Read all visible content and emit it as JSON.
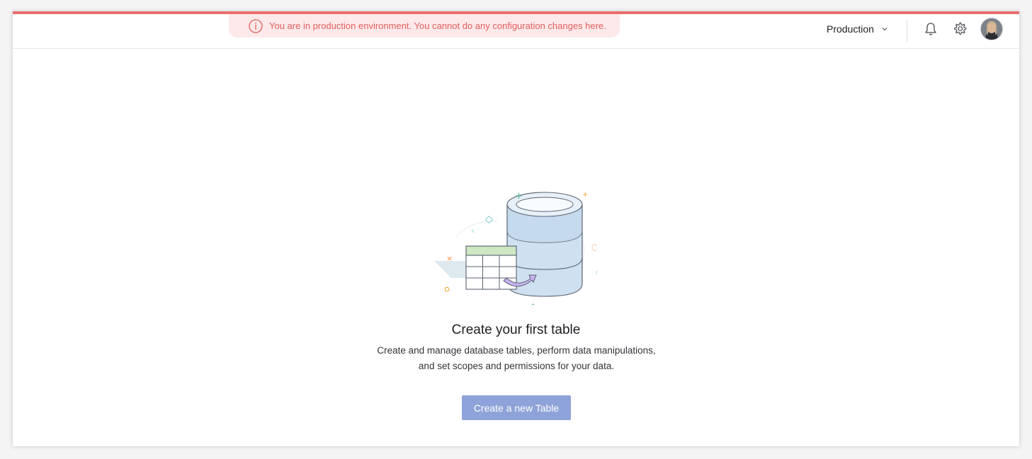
{
  "header": {
    "alert_text": "You are in production environment. You cannot do any configuration changes here.",
    "environment": "Production",
    "icons": [
      "info-icon",
      "chevron-down-icon",
      "bell-icon",
      "gear-icon",
      "avatar"
    ]
  },
  "empty_state": {
    "title": "Create your first table",
    "description_line1": "Create and manage database tables, perform data manipulations,",
    "description_line2": "and set scopes and permissions for your data.",
    "button_label": "Create a new Table"
  },
  "colors": {
    "accent": "#e8706f",
    "alert_bg": "#fde9e9",
    "alert_text": "#e2605f",
    "button_bg": "#8ea3d9"
  }
}
